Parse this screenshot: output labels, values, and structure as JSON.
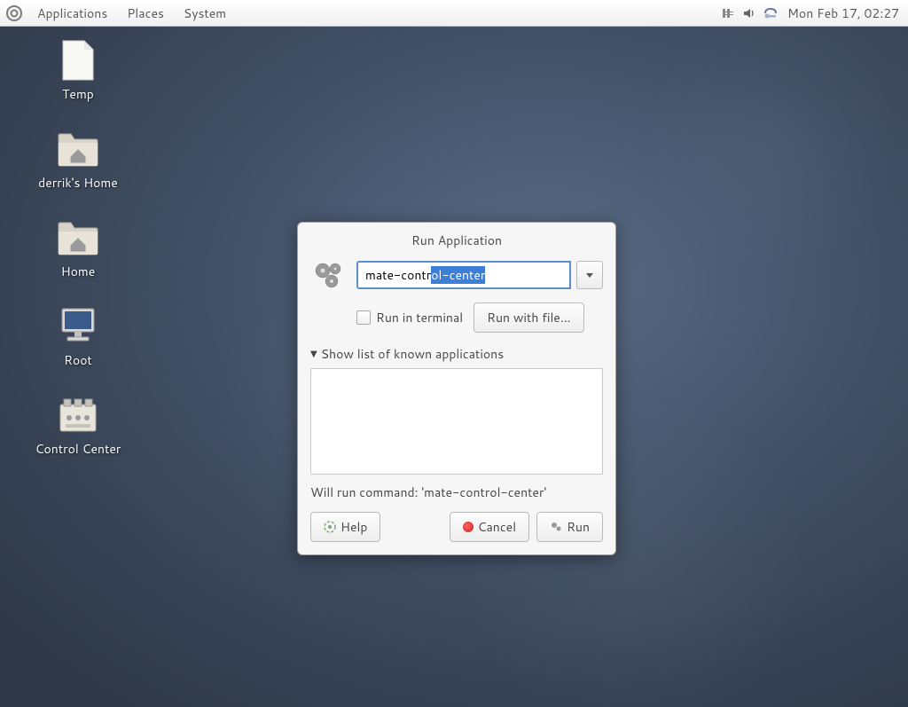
{
  "panel": {
    "menus": [
      "Applications",
      "Places",
      "System"
    ],
    "clock": "Mon Feb 17, 02:27"
  },
  "desktop_icons": [
    {
      "name": "temp",
      "label": "Temp",
      "type": "file"
    },
    {
      "name": "derriks-home",
      "label": "derrik's Home",
      "type": "folder-home"
    },
    {
      "name": "home",
      "label": "Home",
      "type": "folder-home"
    },
    {
      "name": "root",
      "label": "Root",
      "type": "computer"
    },
    {
      "name": "control-center",
      "label": "Control Center",
      "type": "settings"
    }
  ],
  "dialog": {
    "title": "Run Application",
    "command_prefix": "mate-contr",
    "command_selected": "ol-center",
    "run_in_terminal_label": "Run in terminal",
    "run_with_file_label": "Run with file...",
    "expander_label": "Show list of known applications",
    "preview": "Will run command: 'mate-control-center'",
    "help_label": "Help",
    "cancel_label": "Cancel",
    "run_label": "Run"
  }
}
